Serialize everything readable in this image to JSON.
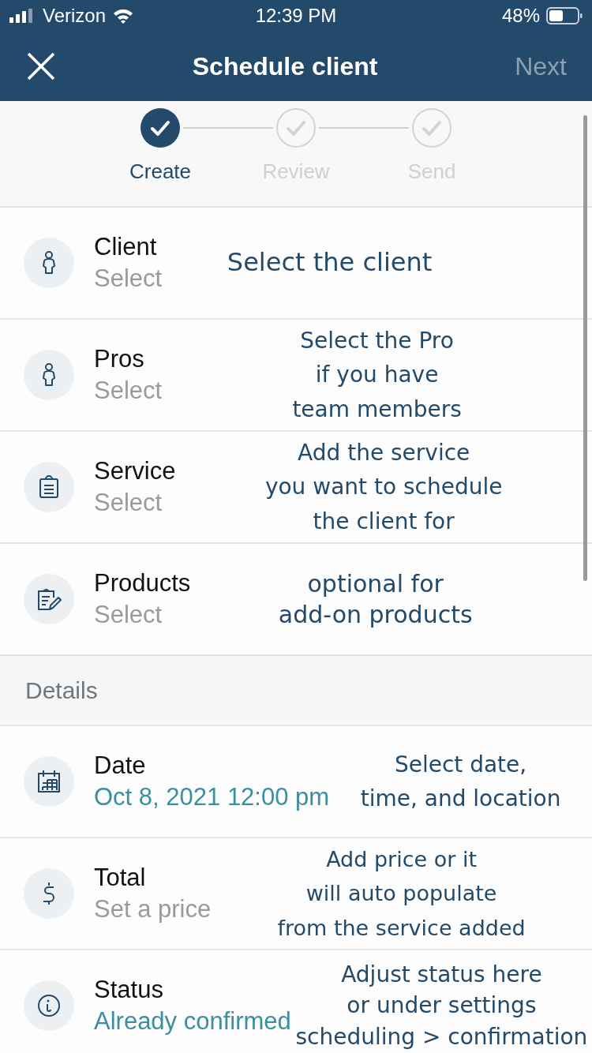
{
  "status_bar": {
    "carrier": "Verizon",
    "time": "12:39 PM",
    "battery": "48%"
  },
  "nav": {
    "title": "Schedule client",
    "next": {
      "label": "Next",
      "disabled": true
    }
  },
  "steps": [
    {
      "label": "Create",
      "completed": true
    },
    {
      "label": "Review",
      "completed": false
    },
    {
      "label": "Send",
      "completed": false
    }
  ],
  "sections": [
    {
      "rows": [
        {
          "kind": "person",
          "label": "Client",
          "value": "Select",
          "filled": false,
          "note": "Select the client"
        },
        {
          "kind": "person",
          "label": "Pros",
          "value": "Select",
          "filled": false,
          "note": "Select the Pro\nif you have\nteam members"
        },
        {
          "kind": "clipboard",
          "label": "Service",
          "value": "Select",
          "filled": false,
          "note": "Add the service\nyou want to schedule\nthe client for"
        },
        {
          "kind": "clipboard-pen",
          "label": "Products",
          "value": "Select",
          "filled": false,
          "note": "optional for\nadd-on products"
        }
      ]
    },
    {
      "header": "Details",
      "rows": [
        {
          "kind": "calendar",
          "label": "Date",
          "value": "Oct 8, 2021 12:00 pm",
          "filled": true,
          "note": "Select date,\ntime, and location"
        },
        {
          "kind": "dollar",
          "label": "Total",
          "value": "Set a price",
          "filled": false,
          "note": "Add price or it\nwill auto populate\nfrom the service added"
        },
        {
          "kind": "info",
          "label": "Status",
          "value": "Already confirmed",
          "filled": true,
          "note": "Adjust status here\nor under settings\nscheduling > confirmation"
        }
      ]
    }
  ]
}
